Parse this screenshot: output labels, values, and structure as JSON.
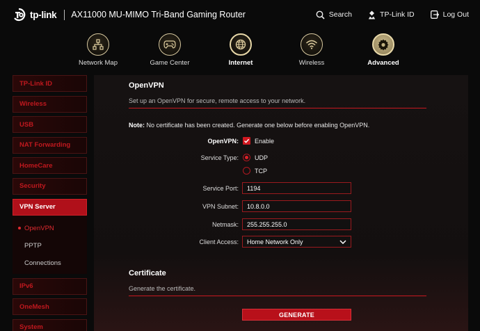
{
  "header": {
    "logo_text": "tp-link",
    "model": "AX11000 MU-MIMO Tri-Band Gaming Router",
    "actions": [
      {
        "label": "Search",
        "icon": "search-icon"
      },
      {
        "label": "TP-Link ID",
        "icon": "user-icon"
      },
      {
        "label": "Log Out",
        "icon": "logout-icon"
      }
    ]
  },
  "nav": {
    "items": [
      {
        "label": "Network Map",
        "icon": "network-map-icon"
      },
      {
        "label": "Game Center",
        "icon": "gamepad-icon"
      },
      {
        "label": "Internet",
        "icon": "globe-icon"
      },
      {
        "label": "Wireless",
        "icon": "wifi-icon"
      },
      {
        "label": "Advanced",
        "icon": "gear-icon"
      }
    ],
    "active": "Advanced"
  },
  "sidebar": {
    "items": [
      {
        "label": "TP-Link ID"
      },
      {
        "label": "Wireless"
      },
      {
        "label": "USB"
      },
      {
        "label": "NAT Forwarding"
      },
      {
        "label": "HomeCare"
      },
      {
        "label": "Security"
      },
      {
        "label": "VPN Server"
      },
      {
        "label": "IPv6"
      },
      {
        "label": "OneMesh"
      },
      {
        "label": "System"
      }
    ],
    "selected": "VPN Server",
    "submenu": [
      {
        "label": "OpenVPN"
      },
      {
        "label": "PPTP"
      },
      {
        "label": "Connections"
      }
    ]
  },
  "openvpn": {
    "title": "OpenVPN",
    "description": "Set up an OpenVPN for secure, remote access to your network.",
    "note_label": "Note:",
    "note_text": " No certificate has been created. Generate one below before enabling OpenVPN.",
    "enable_label": "OpenVPN:",
    "enable_option": "Enable",
    "enabled": true,
    "service_type_label": "Service Type:",
    "service_types": [
      "UDP",
      "TCP"
    ],
    "service_type_selected": "UDP",
    "port_label": "Service Port:",
    "port_value": "1194",
    "subnet_label": "VPN Subnet:",
    "subnet_value": "10.8.0.0",
    "netmask_label": "Netmask:",
    "netmask_value": "255.255.255.0",
    "client_access_label": "Client Access:",
    "client_access_value": "Home Network Only"
  },
  "certificate": {
    "title": "Certificate",
    "description": "Generate the certificate.",
    "button_label": "GENERATE"
  },
  "colors": {
    "accent_red": "#d01820",
    "gold": "#d8c9a0",
    "background": "#0a0a0a"
  }
}
